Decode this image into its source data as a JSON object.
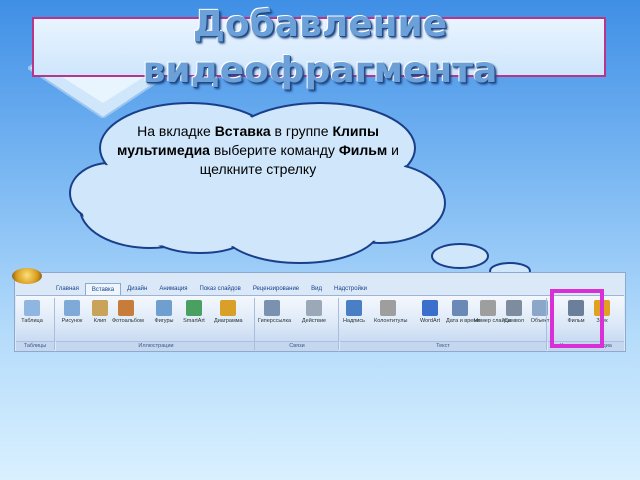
{
  "slide": {
    "title_line1": "Добавление",
    "title_line2": "видеофрагмента"
  },
  "callout": {
    "text_1": "На вкладке ",
    "bold_1": "Вставка",
    "text_2": " в группе ",
    "bold_2": "Клипы мультимедиа",
    "text_3": " выберите команду ",
    "bold_3": "Фильм",
    "text_4": " и щелкните стрелку"
  },
  "ribbon": {
    "tabs": [
      "Главная",
      "Вставка",
      "Дизайн",
      "Анимация",
      "Показ слайдов",
      "Рецензирование",
      "Вид",
      "Надстройки"
    ],
    "active_tab": "Вставка",
    "commands": [
      {
        "label": "Таблица",
        "icon": "table-icon"
      },
      {
        "label": "Рисунок",
        "icon": "picture-icon"
      },
      {
        "label": "Клип",
        "icon": "clipart-icon"
      },
      {
        "label": "Фотоальбом",
        "icon": "photo-album-icon"
      },
      {
        "label": "Фигуры",
        "icon": "shapes-icon"
      },
      {
        "label": "SmartArt",
        "icon": "smartart-icon"
      },
      {
        "label": "Диаграмма",
        "icon": "chart-icon"
      },
      {
        "label": "Гиперссылка",
        "icon": "hyperlink-icon"
      },
      {
        "label": "Действие",
        "icon": "action-icon"
      },
      {
        "label": "Надпись",
        "icon": "textbox-icon"
      },
      {
        "label": "Колонтитулы",
        "icon": "header-footer-icon"
      },
      {
        "label": "WordArt",
        "icon": "wordart-icon"
      },
      {
        "label": "Дата и время",
        "icon": "date-time-icon"
      },
      {
        "label": "Номер слайда",
        "icon": "slide-number-icon"
      },
      {
        "label": "Символ",
        "icon": "symbol-icon"
      },
      {
        "label": "Объект",
        "icon": "object-icon"
      },
      {
        "label": "Фильм",
        "icon": "movie-icon"
      },
      {
        "label": "Звук",
        "icon": "sound-icon"
      }
    ],
    "groups": [
      "Таблицы",
      "Иллюстрации",
      "Связи",
      "Текст",
      "Клипы мультимедиа"
    ]
  },
  "colors": {
    "highlight": "#d92fd6",
    "title_frame": "#b7368a"
  }
}
